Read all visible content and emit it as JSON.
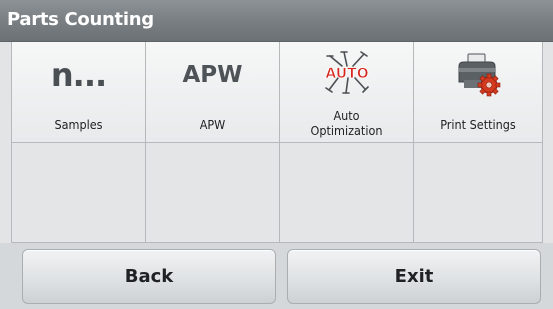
{
  "title": "Parts Counting",
  "tiles": [
    {
      "label": "Samples",
      "icon": "sample-count-icon",
      "icon_text": "n..."
    },
    {
      "label": "APW",
      "icon": "apw-icon",
      "icon_text": "APW"
    },
    {
      "label": "Auto\nOptimization",
      "icon": "auto-optimization-icon",
      "icon_text": "AUTO"
    },
    {
      "label": "Print Settings",
      "icon": "printer-gear-icon"
    }
  ],
  "buttons": {
    "back": "Back",
    "exit": "Exit"
  },
  "colors": {
    "title_bar": "#7a7f83",
    "auto_red": "#d7261e",
    "gear_red": "#d43a1f"
  }
}
